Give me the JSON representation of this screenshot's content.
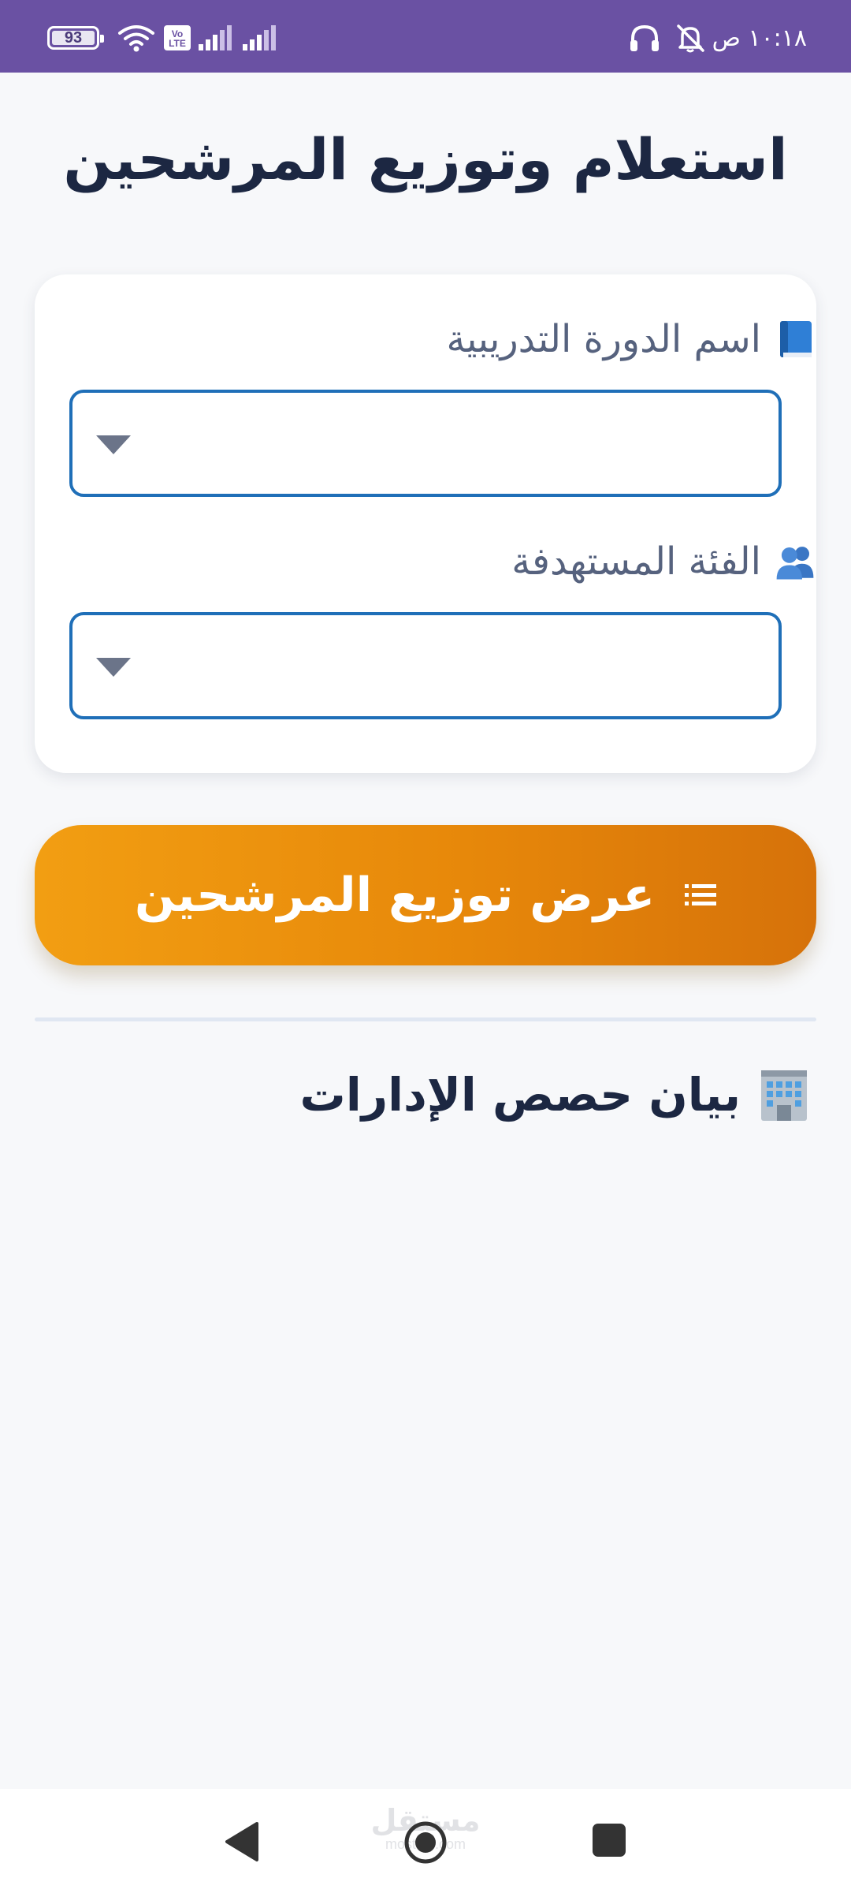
{
  "status_bar": {
    "battery_level": "93",
    "volte_label_top": "Vo",
    "volte_label_bottom": "LTE",
    "time": "١٠:١٨ ص"
  },
  "page": {
    "title": "استعلام وتوزيع المرشحين"
  },
  "form": {
    "course_name_label": "اسم الدورة التدريبية",
    "course_name_icon": "blue-book-icon",
    "course_name_value": "",
    "target_group_label": "الفئة المستهدفة",
    "target_group_icon": "people-icon",
    "target_group_value": ""
  },
  "actions": {
    "show_distribution_label": "عرض توزيع المرشحين",
    "show_distribution_icon": "list-icon"
  },
  "section": {
    "heading": "بيان حصص الإدارات",
    "icon": "office-building-icon"
  },
  "watermark": {
    "text_ar": "مستقل",
    "text_en": "mostaql.com"
  },
  "colors": {
    "status_bar": "#6a51a3",
    "background": "#f7f8fa",
    "select_border": "#1f6fb8",
    "button_gradient_start": "#f29e12",
    "button_gradient_end": "#d6720a",
    "title_text": "#1c2742"
  }
}
